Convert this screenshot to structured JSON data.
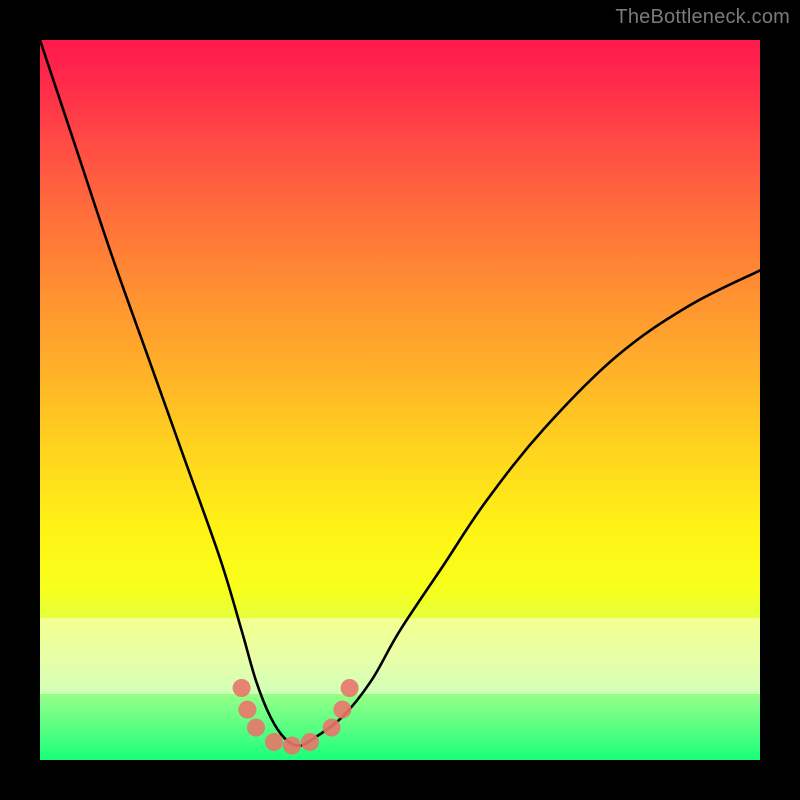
{
  "watermark": "TheBottleneck.com",
  "chart_data": {
    "type": "line",
    "title": "",
    "xlabel": "",
    "ylabel": "",
    "xlim": [
      0,
      100
    ],
    "ylim": [
      0,
      100
    ],
    "grid": false,
    "legend": false,
    "series": [
      {
        "name": "bottleneck-curve",
        "x": [
          0,
          5,
          10,
          15,
          20,
          25,
          28,
          30,
          32,
          34,
          36,
          38,
          42,
          46,
          50,
          56,
          62,
          70,
          80,
          90,
          100
        ],
        "y": [
          100,
          85,
          70,
          56,
          42,
          28,
          18,
          11,
          6,
          3,
          2,
          3,
          6,
          11,
          18,
          27,
          36,
          46,
          56,
          63,
          68
        ]
      }
    ],
    "markers": {
      "name": "highlight-points",
      "points": [
        {
          "x": 28,
          "y": 10
        },
        {
          "x": 28.8,
          "y": 7
        },
        {
          "x": 30,
          "y": 4.5
        },
        {
          "x": 32.5,
          "y": 2.5
        },
        {
          "x": 35,
          "y": 2
        },
        {
          "x": 37.5,
          "y": 2.5
        },
        {
          "x": 40.5,
          "y": 4.5
        },
        {
          "x": 42,
          "y": 7
        },
        {
          "x": 43,
          "y": 10
        }
      ]
    },
    "gradient_stops": [
      {
        "pos": 0.0,
        "color": "#ff1a4d"
      },
      {
        "pos": 0.3,
        "color": "#ff8a33"
      },
      {
        "pos": 0.55,
        "color": "#ffd11f"
      },
      {
        "pos": 0.75,
        "color": "#fff315"
      },
      {
        "pos": 0.9,
        "color": "#88ff88"
      },
      {
        "pos": 1.0,
        "color": "#1aff7a"
      }
    ],
    "minimum_x": 35
  }
}
